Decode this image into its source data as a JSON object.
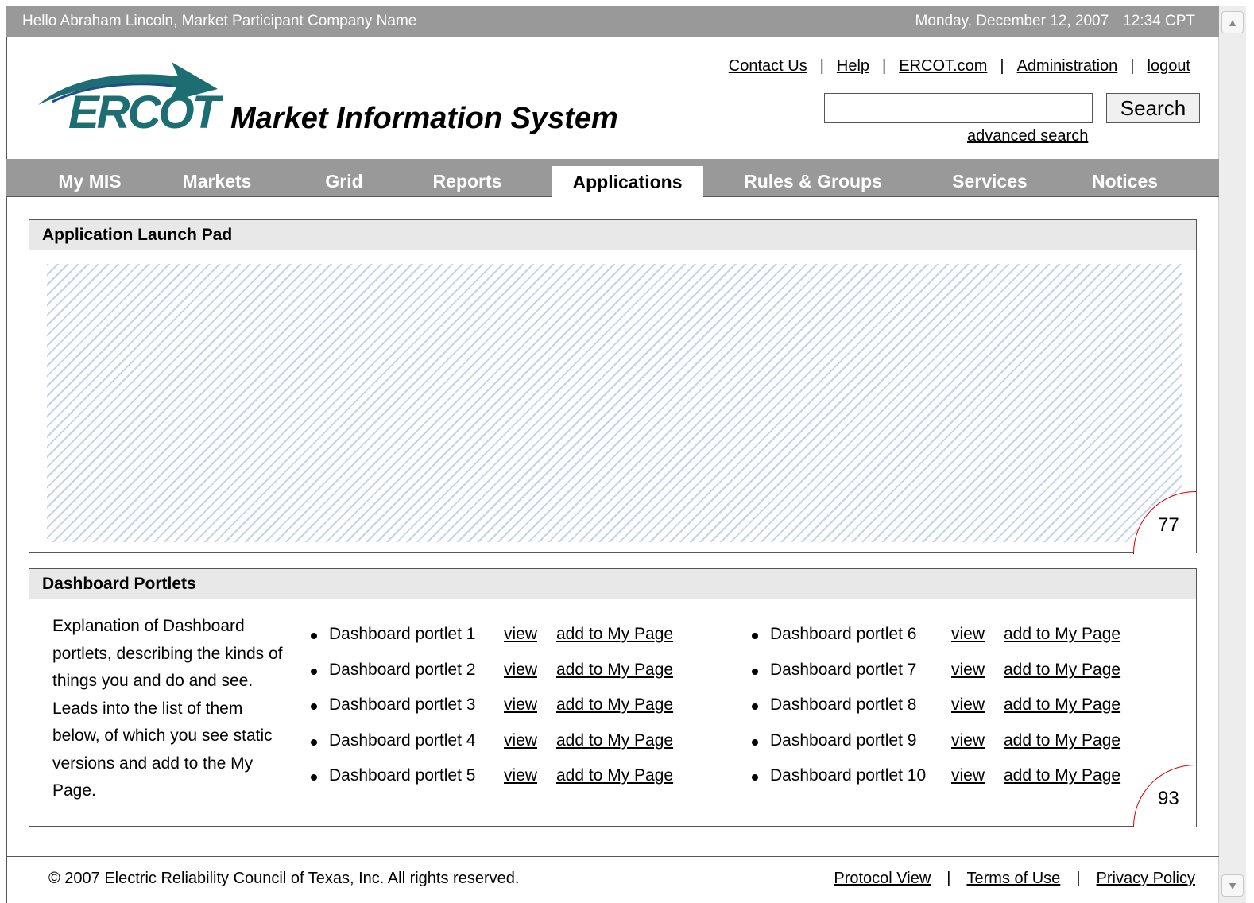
{
  "topbar": {
    "greeting": "Hello Abraham Lincoln, Market Participant Company Name",
    "date": "Monday, December 12, 2007",
    "time": "12:34 CPT",
    "color": "#999999"
  },
  "brand": {
    "logo_text": "ERCOT",
    "app_title": "Market Information System",
    "logo_color": "#1c6e73"
  },
  "toplinks": {
    "contact": "Contact Us",
    "help": "Help",
    "ercot": "ERCOT.com",
    "admin": "Administration",
    "logout": "logout",
    "separator": "|"
  },
  "search": {
    "value": "",
    "button": "Search",
    "advanced": "advanced search"
  },
  "nav": {
    "tabs": [
      {
        "label": "My MIS"
      },
      {
        "label": "Markets"
      },
      {
        "label": "Grid"
      },
      {
        "label": "Reports"
      },
      {
        "label": "Applications"
      },
      {
        "label": "Rules & Groups"
      },
      {
        "label": "Services"
      },
      {
        "label": "Notices"
      }
    ],
    "active": "Applications"
  },
  "launchpad": {
    "title": "Application Launch Pad",
    "badge": "77"
  },
  "dashboard": {
    "title": "Dashboard Portlets",
    "explanation": "Explanation of Dashboard portlets, describing the kinds of things you and do and see. Leads into the list of them below, of which you see static versions and add to the My Page.",
    "badge": "93",
    "view_label": "view",
    "add_label": "add to My Page",
    "portlets": [
      "Dashboard portlet 1",
      "Dashboard portlet 2",
      "Dashboard portlet 3",
      "Dashboard portlet 4",
      "Dashboard portlet 5",
      "Dashboard portlet 6",
      "Dashboard portlet 7",
      "Dashboard portlet 8",
      "Dashboard portlet 9",
      "Dashboard portlet 10"
    ]
  },
  "footer": {
    "copyright": "© 2007 Electric Reliability Council of Texas, Inc.  All rights reserved.",
    "protocol": "Protocol View",
    "terms": "Terms of Use",
    "privacy": "Privacy Policy",
    "separator": "|"
  }
}
